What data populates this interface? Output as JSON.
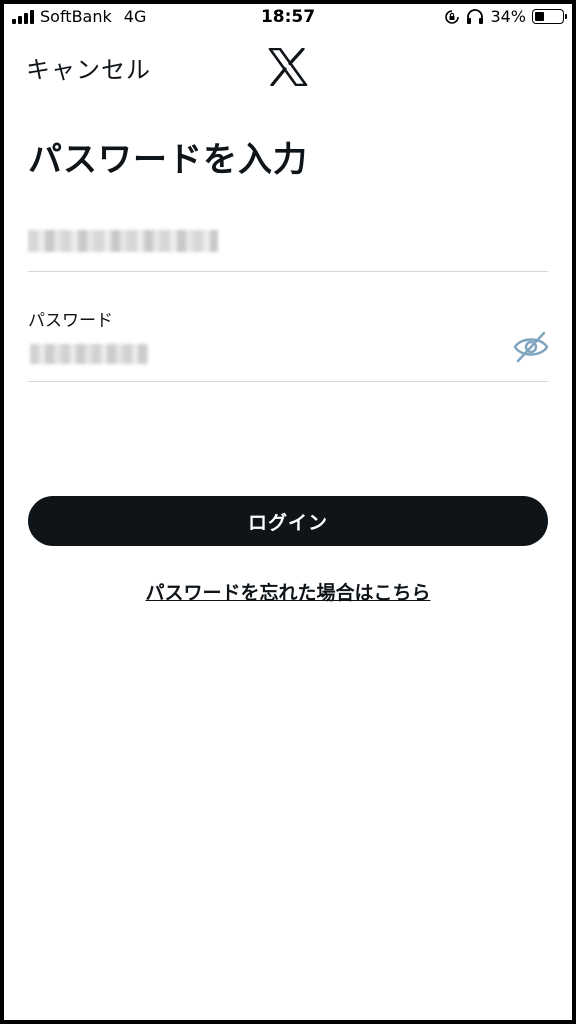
{
  "status_bar": {
    "carrier": "SoftBank",
    "network": "4G",
    "time": "18:57",
    "battery": "34%",
    "battery_level": 0.34
  },
  "nav": {
    "cancel_label": "キャンセル",
    "logo_icon": "x-logo-icon"
  },
  "page": {
    "title": "パスワードを入力"
  },
  "form": {
    "password_label": "パスワード",
    "visibility_icon": "eye-slash-icon"
  },
  "actions": {
    "login_label": "ログイン",
    "forgot_label": "パスワードを忘れた場合はこちら"
  },
  "colors": {
    "text": "#0f1419",
    "button_bg": "#0f1419",
    "divider": "#cfd9de",
    "icon": "#7ea4bf"
  }
}
